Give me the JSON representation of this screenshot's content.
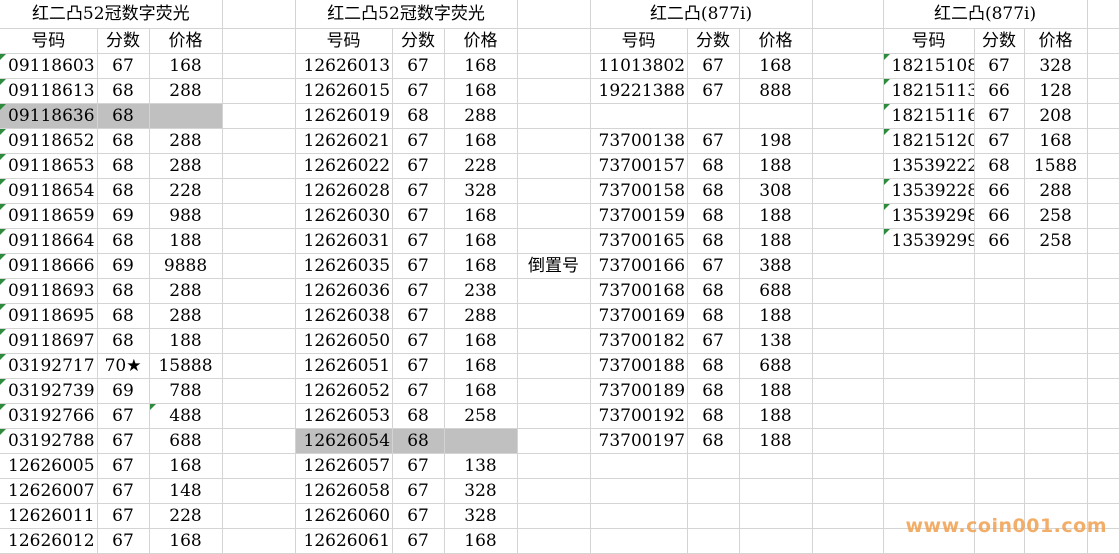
{
  "sections": [
    {
      "title": "红二凸52冠数字荧光"
    },
    {
      "title": "红二凸52冠数字荧光"
    },
    {
      "title": "红二凸(877i)"
    },
    {
      "title": "红二凸(877i)"
    }
  ],
  "headers": [
    "号码",
    "分数",
    "价格"
  ],
  "note": "倒置号",
  "watermark": "www.coin001.com",
  "col1": [
    {
      "n": "09118603",
      "s": "67",
      "p": "168",
      "m": true
    },
    {
      "n": "09118613",
      "s": "68",
      "p": "288",
      "m": true
    },
    {
      "n": "09118636",
      "s": "68",
      "p": "",
      "m": true,
      "g": true
    },
    {
      "n": "09118652",
      "s": "68",
      "p": "288",
      "m": true
    },
    {
      "n": "09118653",
      "s": "68",
      "p": "288",
      "m": true
    },
    {
      "n": "09118654",
      "s": "68",
      "p": "228",
      "m": true
    },
    {
      "n": "09118659",
      "s": "69",
      "p": "988",
      "m": true
    },
    {
      "n": "09118664",
      "s": "68",
      "p": "188",
      "m": true
    },
    {
      "n": "09118666",
      "s": "69",
      "p": "9888",
      "m": true
    },
    {
      "n": "09118693",
      "s": "68",
      "p": "288",
      "m": true
    },
    {
      "n": "09118695",
      "s": "68",
      "p": "288",
      "m": true
    },
    {
      "n": "09118697",
      "s": "68",
      "p": "188",
      "m": true
    },
    {
      "n": "03192717",
      "s": "70★",
      "p": "15888",
      "m": true
    },
    {
      "n": "03192739",
      "s": "69",
      "p": "788",
      "m": true
    },
    {
      "n": "03192766",
      "s": "67",
      "p": "488",
      "m": true,
      "pm": true
    },
    {
      "n": "03192788",
      "s": "67",
      "p": "688",
      "m": true
    },
    {
      "n": "12626005",
      "s": "67",
      "p": "168"
    },
    {
      "n": "12626007",
      "s": "67",
      "p": "148"
    },
    {
      "n": "12626011",
      "s": "67",
      "p": "228"
    },
    {
      "n": "12626012",
      "s": "67",
      "p": "168"
    }
  ],
  "col2": [
    {
      "n": "12626013",
      "s": "67",
      "p": "168"
    },
    {
      "n": "12626015",
      "s": "67",
      "p": "168"
    },
    {
      "n": "12626019",
      "s": "68",
      "p": "288"
    },
    {
      "n": "12626021",
      "s": "67",
      "p": "168"
    },
    {
      "n": "12626022",
      "s": "67",
      "p": "228"
    },
    {
      "n": "12626028",
      "s": "67",
      "p": "328"
    },
    {
      "n": "12626030",
      "s": "67",
      "p": "168"
    },
    {
      "n": "12626031",
      "s": "67",
      "p": "168"
    },
    {
      "n": "12626035",
      "s": "67",
      "p": "168"
    },
    {
      "n": "12626036",
      "s": "67",
      "p": "238"
    },
    {
      "n": "12626038",
      "s": "67",
      "p": "288"
    },
    {
      "n": "12626050",
      "s": "67",
      "p": "168"
    },
    {
      "n": "12626051",
      "s": "67",
      "p": "168"
    },
    {
      "n": "12626052",
      "s": "67",
      "p": "168"
    },
    {
      "n": "12626053",
      "s": "68",
      "p": "258"
    },
    {
      "n": "12626054",
      "s": "68",
      "p": "",
      "g": true
    },
    {
      "n": "12626057",
      "s": "67",
      "p": "138"
    },
    {
      "n": "12626058",
      "s": "67",
      "p": "328"
    },
    {
      "n": "12626060",
      "s": "67",
      "p": "328"
    },
    {
      "n": "12626061",
      "s": "67",
      "p": "168"
    }
  ],
  "col3": [
    {
      "n": "11013802",
      "s": "67",
      "p": "168"
    },
    {
      "n": "19221388",
      "s": "67",
      "p": "888"
    },
    {
      "n": "",
      "s": "",
      "p": ""
    },
    {
      "n": "73700138",
      "s": "67",
      "p": "198"
    },
    {
      "n": "73700157",
      "s": "68",
      "p": "188"
    },
    {
      "n": "73700158",
      "s": "68",
      "p": "308"
    },
    {
      "n": "73700159",
      "s": "68",
      "p": "188"
    },
    {
      "n": "73700165",
      "s": "68",
      "p": "188"
    },
    {
      "n": "73700166",
      "s": "67",
      "p": "388"
    },
    {
      "n": "73700168",
      "s": "68",
      "p": "688"
    },
    {
      "n": "73700169",
      "s": "68",
      "p": "188"
    },
    {
      "n": "73700182",
      "s": "67",
      "p": "138"
    },
    {
      "n": "73700188",
      "s": "68",
      "p": "688"
    },
    {
      "n": "73700189",
      "s": "68",
      "p": "188"
    },
    {
      "n": "73700192",
      "s": "68",
      "p": "188"
    },
    {
      "n": "73700197",
      "s": "68",
      "p": "188"
    }
  ],
  "col4": [
    {
      "n": "18215108",
      "s": "67",
      "p": "328",
      "m": true
    },
    {
      "n": "18215113",
      "s": "66",
      "p": "128",
      "m": true
    },
    {
      "n": "18215116",
      "s": "67",
      "p": "208",
      "m": true
    },
    {
      "n": "18215120",
      "s": "67",
      "p": "168",
      "m": true
    },
    {
      "n": "13539222",
      "s": "68",
      "p": "1588"
    },
    {
      "n": "13539228",
      "s": "66",
      "p": "288",
      "m": true
    },
    {
      "n": "13539298",
      "s": "66",
      "p": "258",
      "m": true
    },
    {
      "n": "13539299",
      "s": "66",
      "p": "258",
      "m": true
    }
  ]
}
